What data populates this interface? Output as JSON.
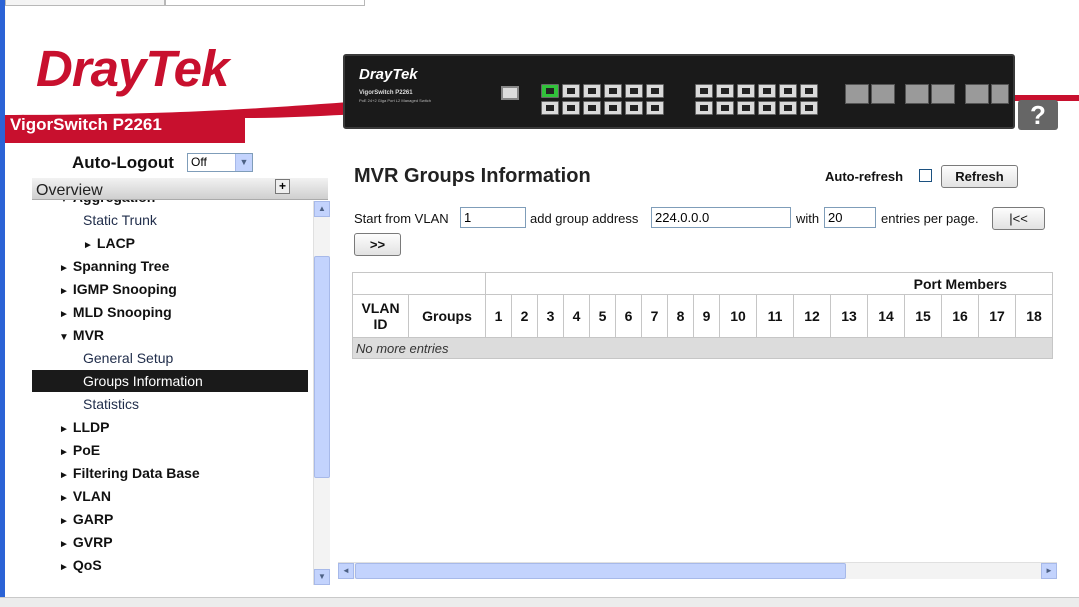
{
  "header": {
    "brand": "DrayTek",
    "model": "VigorSwitch P2261",
    "device_logo": "DrayTek",
    "device_model": "VigorSwitch P2261",
    "device_desc": "PoE 24+2 Giga Port L2 Managed Switch",
    "help_label": "?"
  },
  "nav": {
    "autologout_label": "Auto-Logout",
    "autologout_value": "Off",
    "overview_label": "Overview",
    "items": [
      {
        "label": "Aggregation",
        "kind": "cat",
        "tri": "▼"
      },
      {
        "label": "Static Trunk",
        "kind": "sub"
      },
      {
        "label": "LACP",
        "kind": "sub2",
        "tri": "►"
      },
      {
        "label": "Spanning Tree",
        "kind": "cat",
        "tri": "►"
      },
      {
        "label": "IGMP Snooping",
        "kind": "cat",
        "tri": "►"
      },
      {
        "label": "MLD Snooping",
        "kind": "cat",
        "tri": "►"
      },
      {
        "label": "MVR",
        "kind": "cat",
        "tri": "▼"
      },
      {
        "label": "General Setup",
        "kind": "sub"
      },
      {
        "label": "Groups Information",
        "kind": "sub",
        "selected": true
      },
      {
        "label": "Statistics",
        "kind": "sub"
      },
      {
        "label": "LLDP",
        "kind": "cat",
        "tri": "►"
      },
      {
        "label": "PoE",
        "kind": "cat",
        "tri": "►"
      },
      {
        "label": "Filtering Data Base",
        "kind": "cat",
        "tri": "►"
      },
      {
        "label": "VLAN",
        "kind": "cat",
        "tri": "►"
      },
      {
        "label": "GARP",
        "kind": "cat",
        "tri": "►"
      },
      {
        "label": "GVRP",
        "kind": "cat",
        "tri": "►"
      },
      {
        "label": "QoS",
        "kind": "cat",
        "tri": "►"
      }
    ]
  },
  "main": {
    "title": "MVR Groups Information",
    "autorefresh_label": "Auto-refresh",
    "autorefresh_checked": false,
    "refresh_label": "Refresh",
    "start_label": "Start from VLAN",
    "start_value": "1",
    "group_label": "add group address",
    "group_value": "224.0.0.0",
    "with_label": "with",
    "with_value": "20",
    "entries_label": "entries per page.",
    "first_label": "|<<",
    "next_label": ">>",
    "table": {
      "port_members_label": "Port Members",
      "vlan_label": "VLAN ID",
      "groups_label": "Groups",
      "ports": [
        "1",
        "2",
        "3",
        "4",
        "5",
        "6",
        "7",
        "8",
        "9",
        "10",
        "11",
        "12",
        "13",
        "14",
        "15",
        "16",
        "17",
        "18"
      ],
      "empty_text": "No more entries"
    }
  },
  "colors": {
    "brand_red": "#c8102e",
    "selected_nav": "#1a1a1a",
    "window_edge": "#2b63d6"
  }
}
